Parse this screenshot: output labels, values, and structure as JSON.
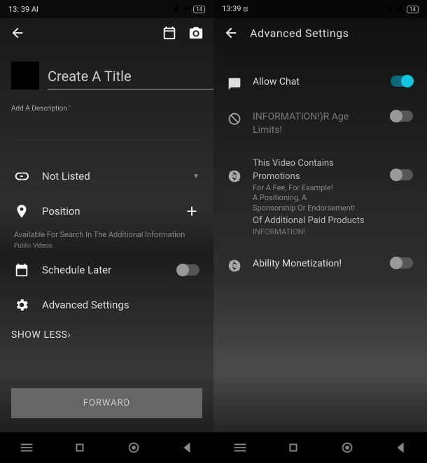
{
  "left": {
    "status": {
      "time": "13: 39 Al",
      "battery": "14"
    },
    "title_placeholder": "Create A Title",
    "desc_label": "Add A Description '",
    "visibility": {
      "label": "Not Listed"
    },
    "position": {
      "label": "Position"
    },
    "search_info": "Available For Search In The Additional Information",
    "search_info_sub": "Public Videos.",
    "schedule": {
      "label": "Schedule Later",
      "on": false
    },
    "advanced": {
      "label": "Advanced Settings"
    },
    "show_less": "SHOW LESS›",
    "forward": "FORWARD"
  },
  "right": {
    "status": {
      "time": "13:39",
      "battery": "14"
    },
    "title": "Advanced Settings",
    "allow_chat": {
      "label": "Allow Chat",
      "on": true
    },
    "age": {
      "label": "INFORMATION!)R Age Limits!",
      "on": false
    },
    "promo": {
      "line1": "This Video Contains Promotions",
      "line2": "For A Fee, For Example!",
      "line3": "A Positioning, A",
      "line4": "Sponsorship Or Endorsement!",
      "line5": "Of Additional Paid Products",
      "info": "INFORMATION!",
      "on": false
    },
    "monetize": {
      "label": "Ability Monetization!",
      "on": false
    }
  }
}
